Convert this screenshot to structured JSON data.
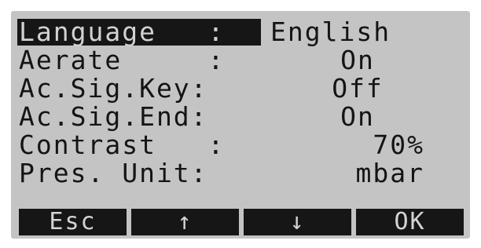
{
  "menu": {
    "items": [
      {
        "label": "Language   :",
        "value": "English"
      },
      {
        "label": "Aerate     :",
        "value": "On"
      },
      {
        "label": "Ac.Sig.Key:",
        "value": "Off"
      },
      {
        "label": "Ac.Sig.End:",
        "value": "On"
      },
      {
        "label": "Contrast   :",
        "value": "70%"
      },
      {
        "label": "Pres. Unit:",
        "value": "mbar"
      }
    ]
  },
  "softkeys": {
    "esc": "Esc",
    "up": "↑",
    "down": "↓",
    "ok": "OK"
  },
  "colors": {
    "lcd_background": "#c4c4c4",
    "lcd_text": "#141414",
    "highlight_background": "#161616",
    "highlight_text": "#d2d2d2"
  }
}
